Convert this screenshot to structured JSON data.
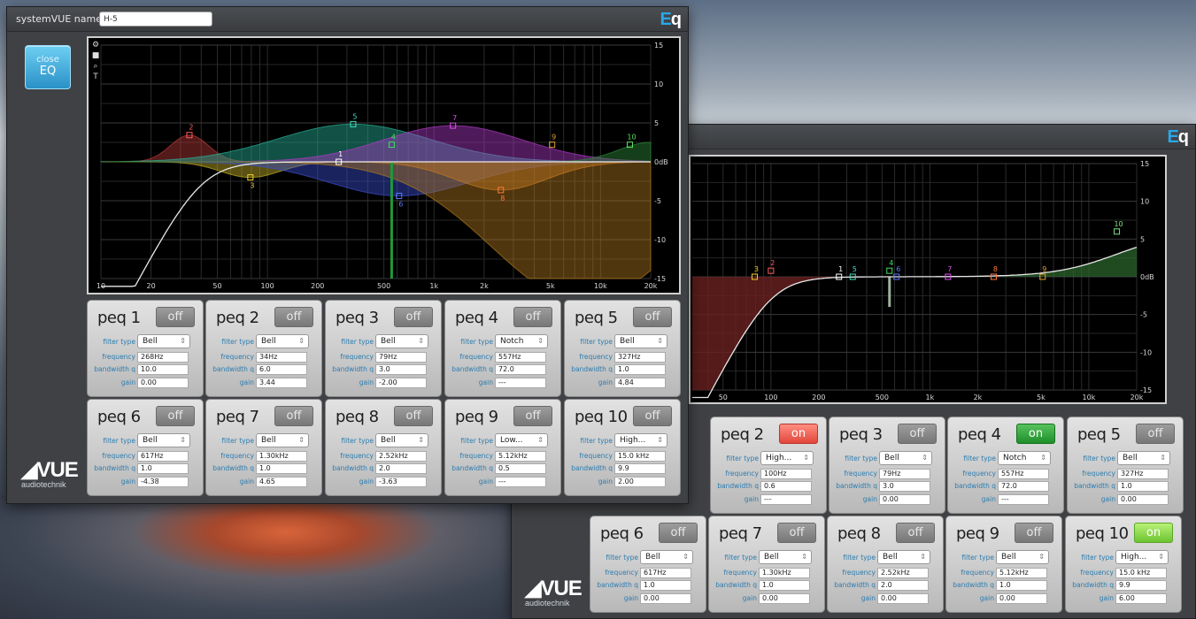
{
  "colors": {
    "accent": "#2aa7e8",
    "on_red": "#e2463a",
    "on_green": "#1e8f2a",
    "on_lime": "#6cc431"
  },
  "front": {
    "system_label": "systemVUE name",
    "system_name": "H-5",
    "logo_e": "E",
    "logo_q": "q",
    "close_line1": "close",
    "close_line2": "EQ",
    "vue_logo": "VUE",
    "vue_sub": "audiotechnik",
    "tool_icons": [
      "settings-icon",
      "camera-icon",
      "zoom-icon",
      "text-icon"
    ],
    "panels": [
      {
        "title": "peq 1",
        "state": "off",
        "type": "Bell",
        "freq": "268Hz",
        "q": "10.0",
        "gain": "0.00"
      },
      {
        "title": "peq 2",
        "state": "off",
        "type": "Bell",
        "freq": "34Hz",
        "q": "6.0",
        "gain": "3.44"
      },
      {
        "title": "peq 3",
        "state": "off",
        "type": "Bell",
        "freq": "79Hz",
        "q": "3.0",
        "gain": "-2.00"
      },
      {
        "title": "peq 4",
        "state": "off",
        "type": "Notch",
        "freq": "557Hz",
        "q": "72.0",
        "gain": "---"
      },
      {
        "title": "peq 5",
        "state": "off",
        "type": "Bell",
        "freq": "327Hz",
        "q": "1.0",
        "gain": "4.84"
      },
      {
        "title": "peq 6",
        "state": "off",
        "type": "Bell",
        "freq": "617Hz",
        "q": "1.0",
        "gain": "-4.38"
      },
      {
        "title": "peq 7",
        "state": "off",
        "type": "Bell",
        "freq": "1.30kHz",
        "q": "1.0",
        "gain": "4.65"
      },
      {
        "title": "peq 8",
        "state": "off",
        "type": "Bell",
        "freq": "2.52kHz",
        "q": "2.0",
        "gain": "-3.63"
      },
      {
        "title": "peq 9",
        "state": "off",
        "type": "Low...",
        "freq": "5.12kHz",
        "q": "0.5",
        "gain": "---"
      },
      {
        "title": "peq 10",
        "state": "off",
        "type": "High...",
        "freq": "15.0 kHz",
        "q": "9.9",
        "gain": "2.00"
      }
    ],
    "graph": {
      "x_ticks": [
        "10",
        "20",
        "50",
        "100",
        "200",
        "500",
        "1k",
        "2k",
        "5k",
        "10k",
        "20k"
      ],
      "y_ticks": [
        "15",
        "10",
        "5",
        "0dB",
        "-5",
        "-10",
        "-15"
      ],
      "markers": [
        "1",
        "2",
        "3",
        "4",
        "5",
        "6",
        "7",
        "8",
        "9",
        "10"
      ]
    }
  },
  "back": {
    "logo_e": "E",
    "logo_q": "q",
    "vue_logo": "VUE",
    "vue_sub": "audiotechnik",
    "panels": [
      {
        "title": "peq 2",
        "state": "on",
        "type": "High...",
        "freq": "100Hz",
        "q": "0.6",
        "gain": "---"
      },
      {
        "title": "peq 3",
        "state": "off",
        "type": "Bell",
        "freq": "79Hz",
        "q": "3.0",
        "gain": "0.00"
      },
      {
        "title": "peq 4",
        "state": "on",
        "type": "Notch",
        "freq": "557Hz",
        "q": "72.0",
        "gain": "---"
      },
      {
        "title": "peq 5",
        "state": "off",
        "type": "Bell",
        "freq": "327Hz",
        "q": "1.0",
        "gain": "0.00"
      },
      {
        "title": "peq 6",
        "state": "off",
        "type": "Bell",
        "freq": "617Hz",
        "q": "1.0",
        "gain": "0.00"
      },
      {
        "title": "peq 7",
        "state": "off",
        "type": "Bell",
        "freq": "1.30kHz",
        "q": "1.0",
        "gain": "0.00"
      },
      {
        "title": "peq 8",
        "state": "off",
        "type": "Bell",
        "freq": "2.52kHz",
        "q": "2.0",
        "gain": "0.00"
      },
      {
        "title": "peq 9",
        "state": "off",
        "type": "Bell",
        "freq": "5.12kHz",
        "q": "1.0",
        "gain": "0.00"
      },
      {
        "title": "peq 10",
        "state": "on",
        "type": "High...",
        "freq": "15.0 kHz",
        "q": "9.9",
        "gain": "6.00"
      }
    ],
    "graph": {
      "x_ticks": [
        "50",
        "100",
        "200",
        "500",
        "1k",
        "2k",
        "5k",
        "10k",
        "20k"
      ],
      "y_ticks": [
        "15",
        "10",
        "5",
        "0dB",
        "-5",
        "-10",
        "-15"
      ],
      "markers": [
        "1",
        "2",
        "3",
        "4",
        "5",
        "6",
        "7",
        "8",
        "9",
        "10"
      ]
    }
  },
  "labels": {
    "filter_type": "filter type",
    "frequency": "frequency",
    "bandwidth": "bandwidth q",
    "gain": "gain"
  }
}
